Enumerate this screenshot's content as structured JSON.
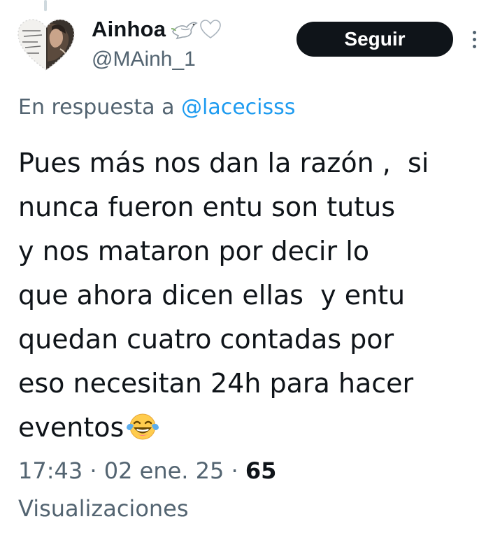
{
  "author": {
    "display_name": "Ainhoa",
    "handle": "@MAinh_1",
    "name_emoji": [
      "dove-emoji",
      "white-heart-emoji"
    ]
  },
  "actions": {
    "follow_label": "Seguir",
    "more_icon": "more-vertical-icon"
  },
  "reply": {
    "prefix": "En respuesta a ",
    "mention": "@lacecisss"
  },
  "tweet": {
    "lines": [
      "Pues más nos dan la razón ,  si",
      "nunca fueron entu son tutus",
      "y nos mataron por decir lo",
      "que ahora dicen ellas  y entu",
      "quedan cuatro contadas por",
      "eso necesitan 24h para hacer",
      "eventos"
    ],
    "trailing_emoji": "face-with-tears-of-joy-emoji"
  },
  "meta": {
    "time": "17:43",
    "separator": " · ",
    "date": "02 ene. 25",
    "views_count": "65",
    "views_label": "Visualizaciones"
  },
  "colors": {
    "text_primary": "#0f1419",
    "text_secondary": "#536471",
    "link": "#1d9bf0",
    "button_bg": "#0f1419",
    "button_text": "#ffffff"
  }
}
